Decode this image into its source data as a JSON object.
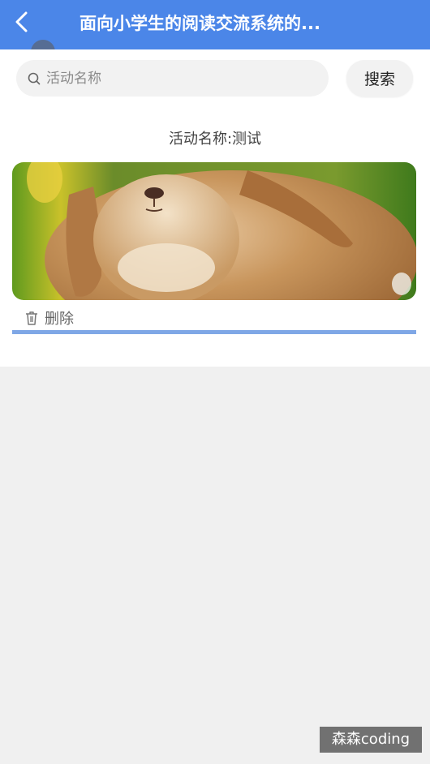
{
  "header": {
    "title": "面向小学生的阅读交流系统的...",
    "back_icon": "chevron-left-icon",
    "background_color": "#4b86e8"
  },
  "search": {
    "placeholder": "活动名称",
    "value": "",
    "button_label": "搜索",
    "icon": "search-icon"
  },
  "activity": {
    "name_label": "活动名称:测试",
    "image_subject": "rabbit photo",
    "delete_label": "删除",
    "delete_icon": "trash-icon",
    "divider_color": "#7fa7e6"
  },
  "watermark": {
    "text": "森森coding"
  }
}
